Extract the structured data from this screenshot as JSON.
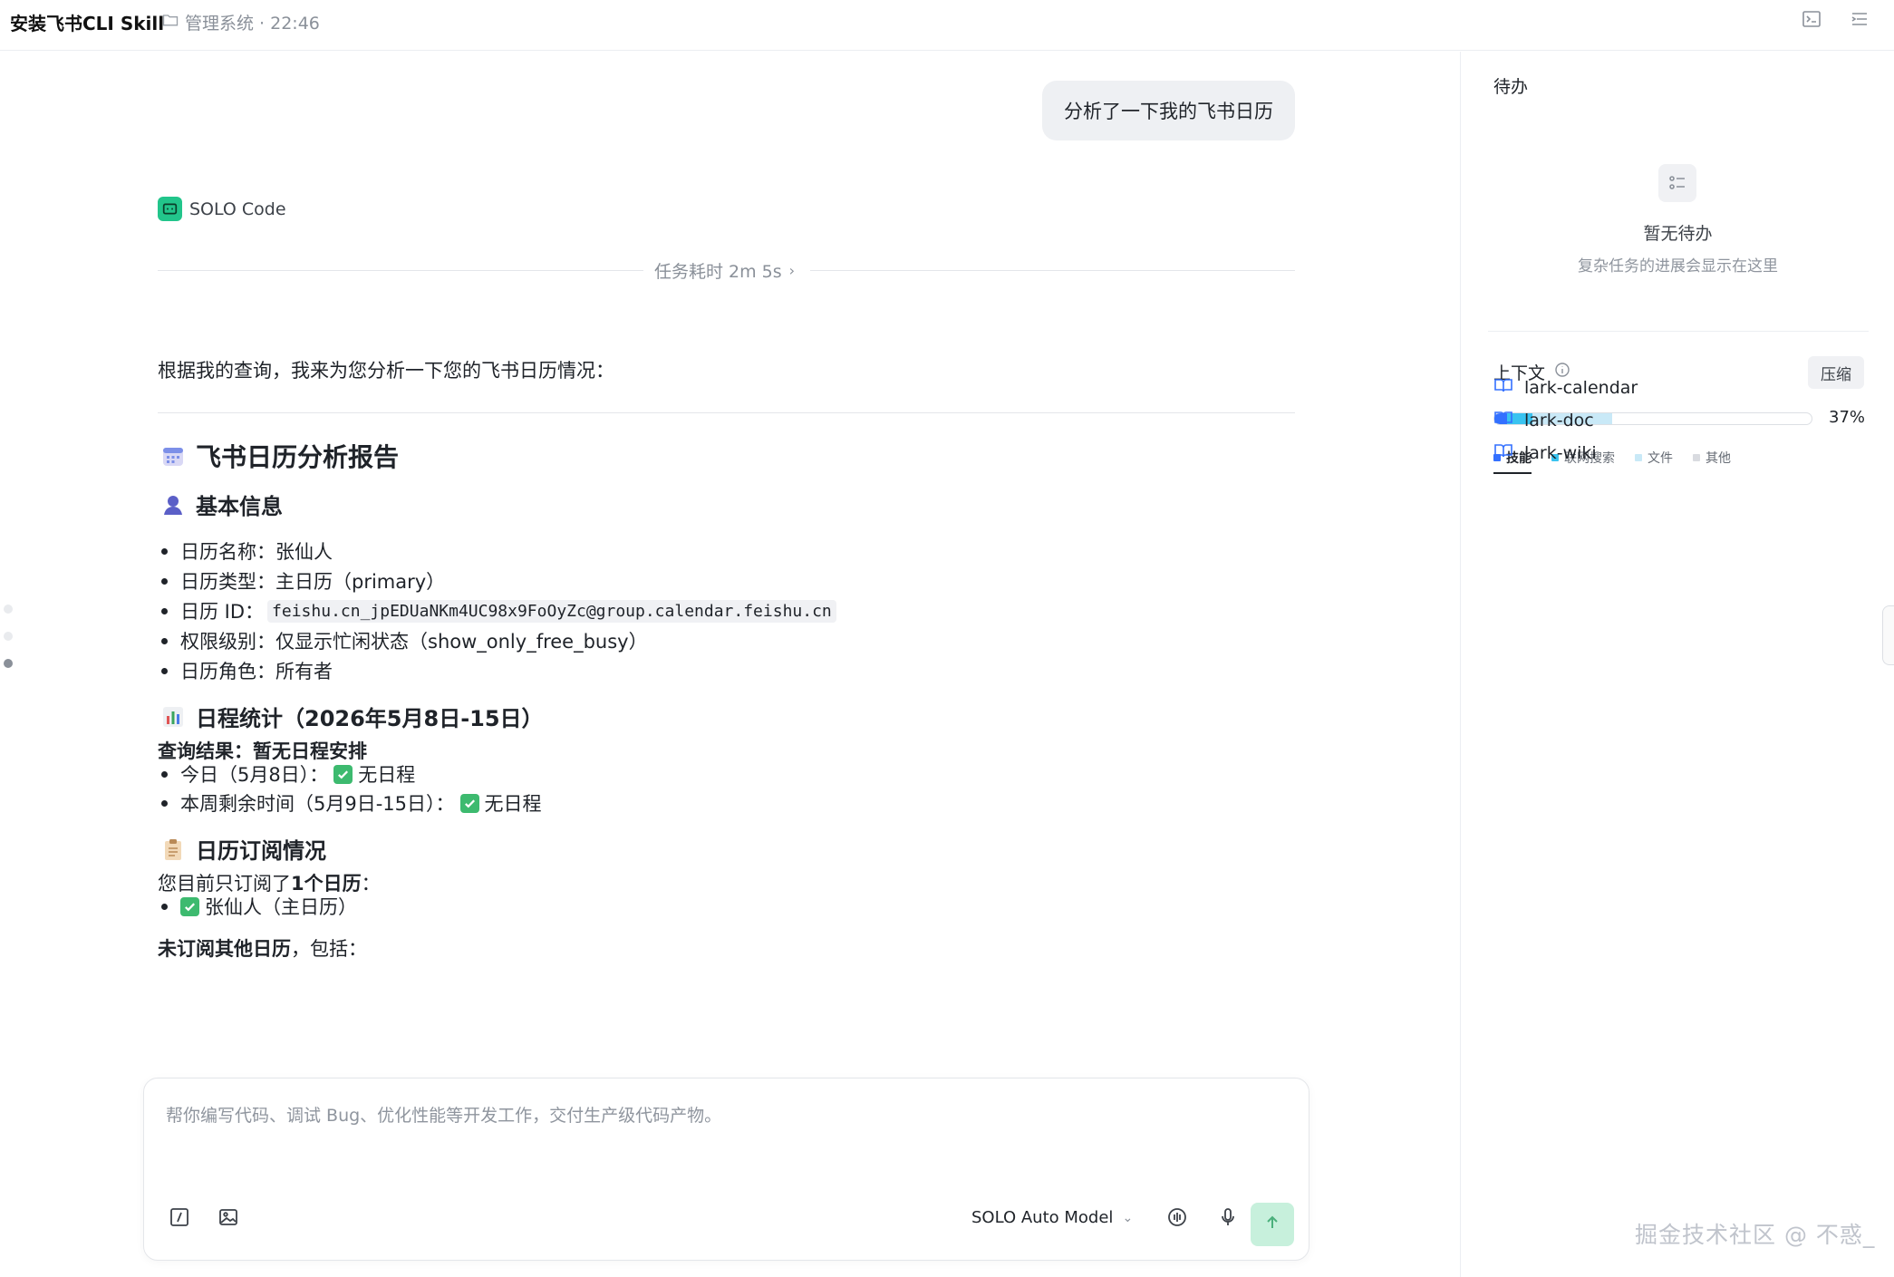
{
  "header": {
    "title": "安装飞书CLI Skill",
    "project": "管理系统 · 22:46",
    "icons": [
      "terminal-icon",
      "outline-icon"
    ]
  },
  "chat": {
    "user_message": "分析了一下我的飞书日历",
    "agent_name": "SOLO Code",
    "task_duration": "任务耗时 2m 5s",
    "intro": "根据我的查询，我来为您分析一下您的飞书日历情况：",
    "report": {
      "title": "飞书日历分析报告",
      "basic": {
        "heading": "基本信息",
        "items": [
          "日历名称：张仙人",
          "日历类型：主日历（primary）",
          "日历 ID：",
          "权限级别：仅显示忙闲状态（show_only_free_busy）",
          "日历角色：所有者"
        ],
        "calendar_id": "feishu.cn_jpEDUaNKm4UC98x9FoOyZc@group.calendar.feishu.cn"
      },
      "stats": {
        "heading": "日程统计（2026年5月8日-15日）",
        "result_label": "查询结果：暂无日程安排",
        "items": [
          {
            "label": "今日（5月8日）：",
            "value": "无日程"
          },
          {
            "label": "本周剩余时间（5月9日-15日）：",
            "value": "无日程"
          }
        ]
      },
      "subs": {
        "heading": "日历订阅情况",
        "line_prefix": "您目前只订阅了",
        "line_bold": "1个日历",
        "line_suffix": "：",
        "items": [
          "张仙人（主日历）"
        ],
        "unsub_bold": "未订阅其他日历",
        "unsub_suffix": "，包括："
      }
    }
  },
  "input": {
    "placeholder": "帮你编写代码、调试 Bug、优化性能等开发工作，交付生产级代码产物。",
    "model": "SOLO Auto Model"
  },
  "panel": {
    "todo": {
      "title": "待办",
      "empty_title": "暂无待办",
      "empty_sub": "复杂任务的进展会显示在这里"
    },
    "context": {
      "title": "上下文",
      "compress": "压缩",
      "percent_label": "37%",
      "usage": {
        "skills": 0.04,
        "web_search": 0.08,
        "files": 0.25,
        "total": 0.37
      },
      "colors": {
        "skills": "#3370ff",
        "web_search": "#39c3f0",
        "files": "#c9e9f7",
        "other": "#d9dbe0"
      },
      "legend": [
        "技能",
        "联网搜索",
        "文件",
        "其他"
      ],
      "skills": [
        "lark-calendar",
        "lark-doc",
        "lark-wiki"
      ]
    },
    "watermark": "掘金技术社区 @ 不惑_"
  }
}
